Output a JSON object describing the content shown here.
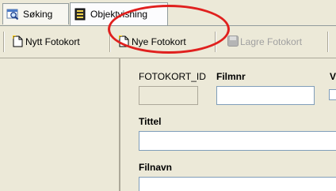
{
  "tabs": [
    {
      "label": "Søking",
      "icon": "search-icon"
    },
    {
      "label": "Objektvisning",
      "icon": "form-view-icon"
    }
  ],
  "toolbar": {
    "nytt_fotokort": "Nytt Fotokort",
    "nye_fotokort": "Nye Fotokort",
    "lagre_fotokort": "Lagre Fotokort"
  },
  "form": {
    "fotokort_id_label": "FOTOKORT_ID",
    "filmnr_label": "Filmnr",
    "v_label": "V",
    "tittel_label": "Tittel",
    "filnavn_label": "Filnavn"
  },
  "colors": {
    "annotation": "#e0201e",
    "chrome": "#ece9d8"
  }
}
